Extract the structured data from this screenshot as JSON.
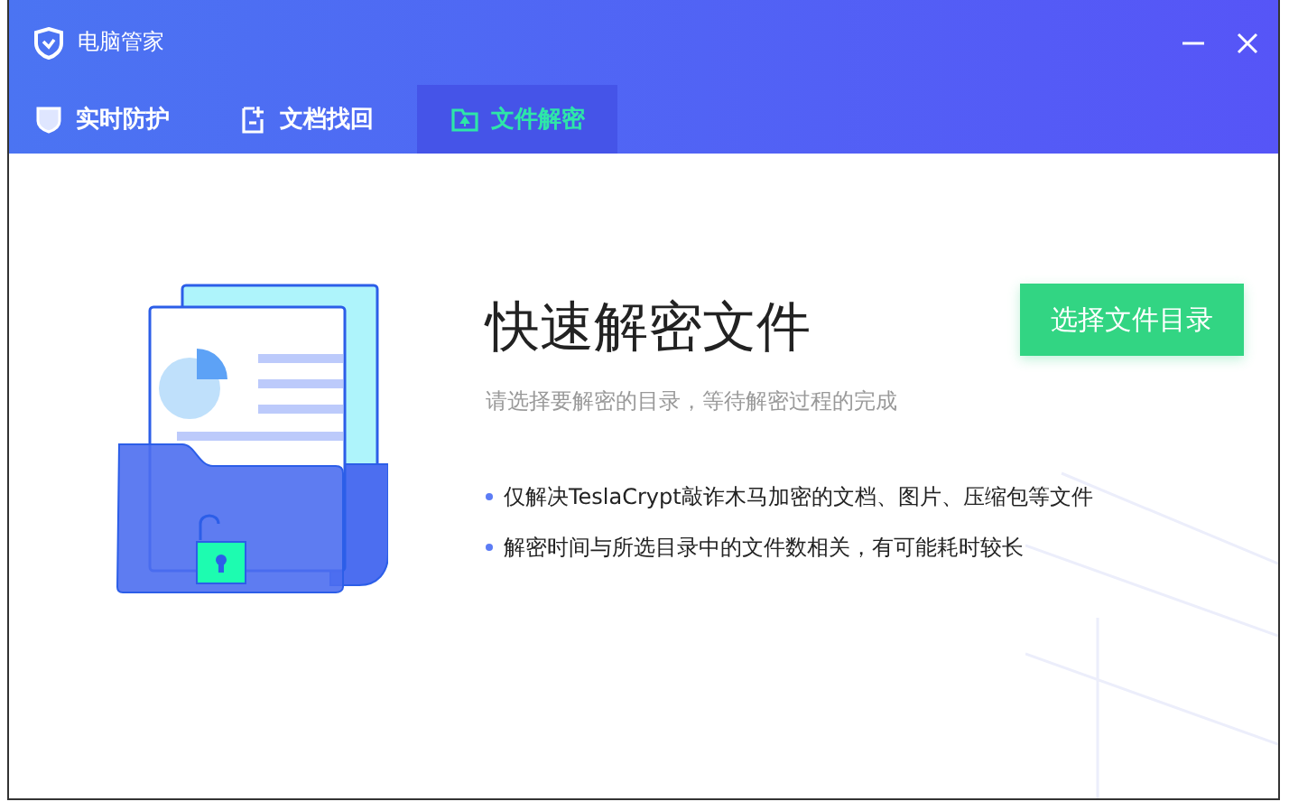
{
  "window": {
    "title": "电脑管家"
  },
  "tabs": [
    {
      "label": "实时防护",
      "kind": "shield",
      "selected": false
    },
    {
      "label": "文档找回",
      "kind": "doc",
      "selected": false
    },
    {
      "label": "文件解密",
      "kind": "folder",
      "selected": true
    }
  ],
  "content": {
    "heading": "快速解密文件",
    "subtitle": "请选择要解密的目录，等待解密过程的完成",
    "button": "选择文件目录",
    "notes": [
      "仅解决TeslaCrypt敲诈木马加密的文档、图片、压缩包等文件",
      "解密时间与所选目录中的文件数相关，有可能耗时较长"
    ]
  }
}
